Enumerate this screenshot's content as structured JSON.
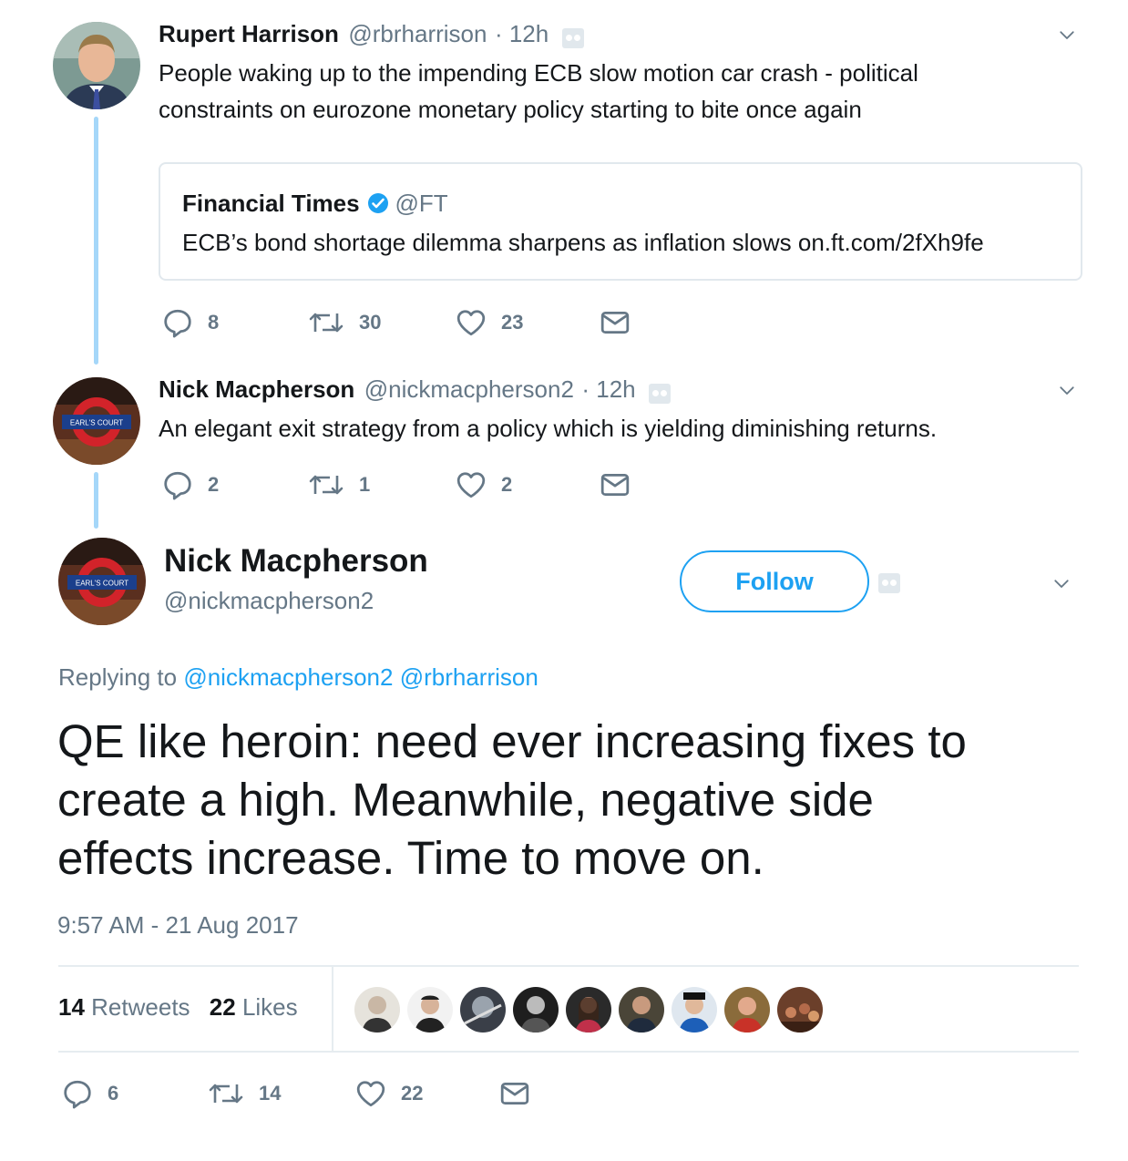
{
  "thread": [
    {
      "author_name": "Rupert Harrison",
      "handle": "@rbrharrison",
      "time": "· 12h",
      "text_line1": "People waking up to the impending ECB slow motion car crash - political",
      "text_line2": "constraints on eurozone monetary policy starting to bite once again",
      "quote": {
        "author_name": "Financial Times",
        "handle": "@FT",
        "text": "ECB’s bond shortage dilemma sharpens as inflation slows on.ft.com/2fXh9fe"
      },
      "replies": "8",
      "retweets": "30",
      "likes": "23"
    },
    {
      "author_name": "Nick Macpherson",
      "handle": "@nickmacpherson2",
      "time": "· 12h",
      "text_line1": "An elegant exit strategy from a policy which is yielding diminishing returns.",
      "replies": "2",
      "retweets": "1",
      "likes": "2",
      "avatar_sign": "EARL'S COURT"
    }
  ],
  "main": {
    "author_name": "Nick Macpherson",
    "handle": "@nickmacpherson2",
    "avatar_sign": "EARL'S COURT",
    "follow_label": "Follow",
    "replying_prefix": "Replying to",
    "replying_to": [
      "@nickmacpherson2",
      "@rbrharrison"
    ],
    "text_line1": "QE like heroin: need ever increasing fixes to",
    "text_line2": "create a high. Meanwhile, negative side",
    "text_line3": "effects increase. Time to move on.",
    "timestamp": "9:57 AM - 21 Aug 2017",
    "retweets_count": "14",
    "retweets_label": "Retweets",
    "likes_count": "22",
    "likes_label": "Likes",
    "replies": "6",
    "retweets": "14",
    "likes": "22"
  },
  "colors": {
    "accent": "#1da1f2",
    "muted": "#657786",
    "thread_line": "#a5d7f9"
  },
  "icons": [
    "reply-icon",
    "retweet-icon",
    "heart-icon",
    "mail-icon",
    "chevron-down-icon",
    "egg-icon"
  ]
}
